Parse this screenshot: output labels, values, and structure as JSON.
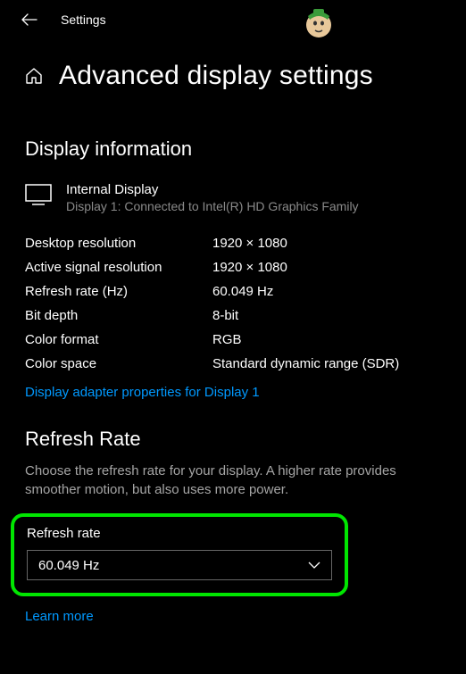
{
  "header": {
    "title": "Settings"
  },
  "page": {
    "title": "Advanced display settings"
  },
  "display_info": {
    "heading": "Display information",
    "name": "Internal Display",
    "sub": "Display 1: Connected to Intel(R) HD Graphics Family",
    "props": [
      {
        "label": "Desktop resolution",
        "value": "1920 × 1080"
      },
      {
        "label": "Active signal resolution",
        "value": "1920 × 1080"
      },
      {
        "label": "Refresh rate (Hz)",
        "value": "60.049 Hz"
      },
      {
        "label": "Bit depth",
        "value": "8-bit"
      },
      {
        "label": "Color format",
        "value": "RGB"
      },
      {
        "label": "Color space",
        "value": "Standard dynamic range (SDR)"
      }
    ],
    "adapter_link": "Display adapter properties for Display 1"
  },
  "refresh": {
    "heading": "Refresh Rate",
    "description": "Choose the refresh rate for your display. A higher rate provides smoother motion, but also uses more power.",
    "field_label": "Refresh rate",
    "selected": "60.049 Hz",
    "learn_more": "Learn more"
  }
}
